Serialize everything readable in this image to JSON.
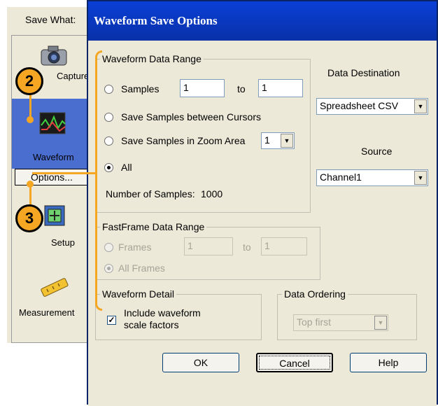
{
  "left_panel": {
    "header": "Save What:",
    "items": [
      {
        "label": "Capture",
        "icon": "camera-icon"
      },
      {
        "label": "Waveform",
        "icon": "waveform-icon",
        "selected": true
      },
      {
        "label": "Setup",
        "icon": "setup-icon"
      },
      {
        "label": "Measurement",
        "icon": "ruler-icon"
      }
    ],
    "options_button": "Options...",
    "callouts": [
      "2",
      "3"
    ]
  },
  "dialog": {
    "title": "Waveform Save Options",
    "waveform_data_range": {
      "legend": "Waveform Data Range",
      "samples_label": "Samples",
      "samples_from": "1",
      "to_label": "to",
      "samples_to": "1",
      "between_cursors_label": "Save Samples between Cursors",
      "zoom_area_label": "Save Samples in Zoom Area",
      "zoom_area_value": "1",
      "all_label": "All",
      "selected": "All",
      "num_samples_label": "Number of Samples:",
      "num_samples_value": "1000"
    },
    "data_destination": {
      "label": "Data Destination",
      "value": "Spreadsheet CSV"
    },
    "source": {
      "label": "Source",
      "value": "Channel1"
    },
    "fastframe": {
      "legend": "FastFrame Data Range",
      "frames_label": "Frames",
      "frames_from": "1",
      "to_label": "to",
      "frames_to": "1",
      "all_frames_label": "All Frames"
    },
    "waveform_detail": {
      "legend": "Waveform Detail",
      "include_line1": "Include waveform",
      "include_line2": "scale factors",
      "checked": true
    },
    "data_ordering": {
      "legend": "Data Ordering",
      "value": "Top first"
    },
    "buttons": {
      "ok": "OK",
      "cancel": "Cancel",
      "help": "Help"
    }
  },
  "colors": {
    "title_bar": "#0a3fd6",
    "dialog_bg": "#ece9d8",
    "callout": "#f5a623",
    "selection": "#4a6ed0"
  }
}
